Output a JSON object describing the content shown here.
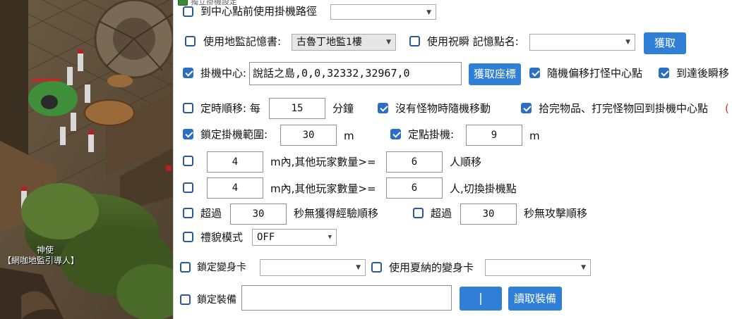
{
  "window": {
    "title": "獨立掛機設定",
    "title_icon": "app-icon"
  },
  "game": {
    "npc_name": "神使",
    "npc_title": "【網咖地監引導人】"
  },
  "row0": {
    "label": "到中心點前使用掛機路徑"
  },
  "row1": {
    "use_scroll_label": "使用地監記憶書:",
    "scroll_value": "古魯丁地監1樓",
    "blessed_teleport_label": "使用祝瞬 記憶點名:",
    "memory_point_value": "",
    "fetch_label": "獲取"
  },
  "row2": {
    "center_label": "掛機中心:",
    "center_value": "說話之島,0,0,32332,32967,0",
    "fetch_coords_label": "獲取座標",
    "random_offset_label": "隨機偏移打怪中心點",
    "teleport_after_label": "到達後瞬移"
  },
  "row3": {
    "timed_move_label": "定時順移: 每",
    "timed_move_value": "15",
    "minutes_label": "分鐘",
    "random_move_label": "沒有怪物時隨機移動",
    "return_center_label": "拾完物品、打完怪物回到掛機中心點",
    "overflow_char": "("
  },
  "row4": {
    "lock_range_label": "鎖定掛機範圍:",
    "lock_range_value": "30",
    "lock_range_unit": "m",
    "fixed_point_label": "定點掛機:",
    "fixed_point_value": "9",
    "fixed_point_unit": "m"
  },
  "row5": {
    "range_value": "4",
    "players_label": "m內,其他玩家數量>=",
    "count_value": "6",
    "suffix_label": "人順移"
  },
  "row6": {
    "range_value": "4",
    "players_label": "m內,其他玩家數量>=",
    "count_value": "6",
    "suffix_label": "人,切換掛機點"
  },
  "row7": {
    "exp_prefix": "超過",
    "exp_value": "30",
    "exp_suffix": "秒無獲得經驗順移",
    "atk_prefix": "超過",
    "atk_value": "30",
    "atk_suffix": "秒無攻擊順移"
  },
  "row8": {
    "polite_label": "禮貌模式",
    "polite_value": "OFF"
  },
  "row9": {
    "lock_card_label": "鎖定變身卡",
    "lock_card_value": "",
    "xiana_card_label": "使用夏納的變身卡",
    "xiana_card_value": ""
  },
  "row10": {
    "lock_equip_label": "鎖定裝備",
    "equip_value": "",
    "pipe_label": "|",
    "read_equip_label": "讀取裝備"
  },
  "colors": {
    "accent": "#2f7fd6",
    "checkbox": "#2b6fc4",
    "overflow_red": "#e0302a"
  }
}
